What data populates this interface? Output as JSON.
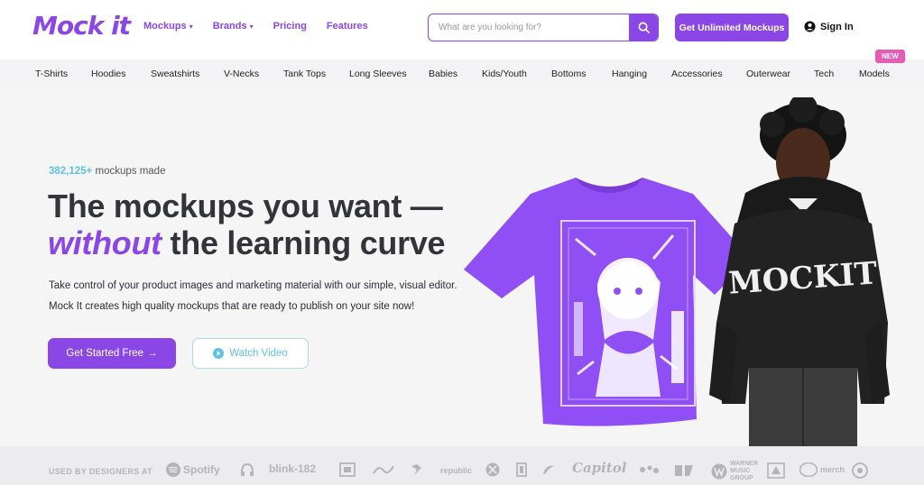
{
  "header": {
    "logo": "Mock it",
    "nav": [
      {
        "label": "Mockups",
        "dropdown": true
      },
      {
        "label": "Brands",
        "dropdown": true
      },
      {
        "label": "Pricing",
        "dropdown": false
      },
      {
        "label": "Features",
        "dropdown": false
      }
    ],
    "search_placeholder": "What are you looking for?",
    "cta_label": "Get Unlimited Mockups",
    "signin_label": "Sign In"
  },
  "categories": [
    "T-Shirts",
    "Hoodies",
    "Sweatshirts",
    "V-Necks",
    "Tank Tops",
    "Long Sleeves",
    "Babies",
    "Kids/Youth",
    "Bottoms",
    "Hanging",
    "Accessories",
    "Outerwear",
    "Tech",
    "Models"
  ],
  "new_badge": "NEW",
  "hero": {
    "count_number": "382,125+",
    "count_suffix": " mockups made",
    "headline_line1": "The mockups you want —",
    "headline_accent": "without",
    "headline_rest": " the learning curve",
    "description": "Take control of your product images and marketing material with our simple, visual editor. Mock It creates high quality mockups that are ready to publish on your site now!",
    "primary_button": "Get Started Free",
    "secondary_button": "Watch Video",
    "hoodie_print": "MOCKIT"
  },
  "logos": {
    "used_by": "USED BY DESIGNERS AT",
    "brands": [
      "Spotify",
      "blink-182",
      "republic",
      "Capitol",
      "WARNER MUSIC GROUP",
      "merch"
    ]
  },
  "colors": {
    "accent": "#8b46e6",
    "teal": "#5ec3e0",
    "badge": "#e55bb5"
  }
}
